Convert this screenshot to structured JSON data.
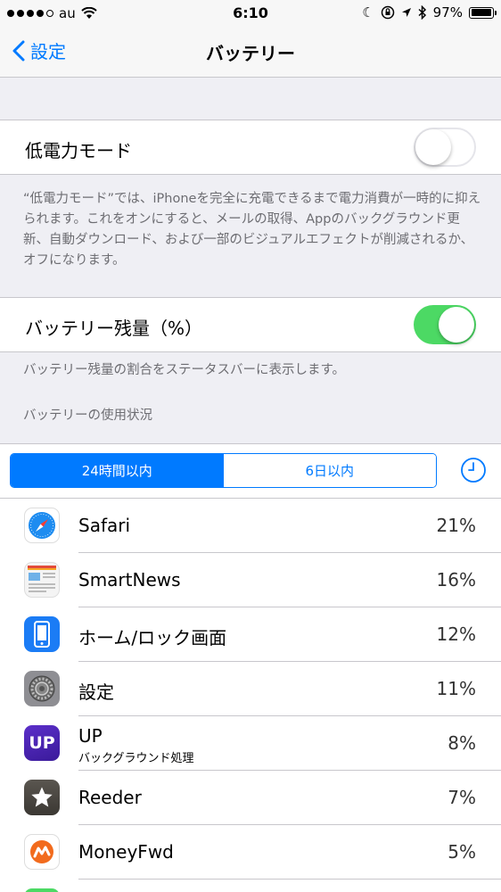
{
  "status": {
    "carrier": "au",
    "time": "6:10",
    "battery": "97%",
    "battery_level": 0.97
  },
  "nav": {
    "back_label": "設定",
    "title": "バッテリー"
  },
  "low_power": {
    "label": "低電力モード",
    "on": false,
    "footnote": "“低電力モード”では、iPhoneを完全に充電できるまで電力消費が一時的に抑えられます。これをオンにすると、メールの取得、Appのバックグラウンド更新、自動ダウンロード、および一部のビジュアルエフェクトが削減されるか、オフになります。"
  },
  "battery_pct": {
    "label": "バッテリー残量（%）",
    "on": true,
    "footnote": "バッテリー残量の割合をステータスバーに表示します。"
  },
  "usage": {
    "header": "バッテリーの使用状況",
    "segments": [
      "24時間以内",
      "6日以内"
    ],
    "selected": 0,
    "apps": [
      {
        "name": "Safari",
        "sub": "",
        "percent": "21%",
        "icon": "safari-icon"
      },
      {
        "name": "SmartNews",
        "sub": "",
        "percent": "16%",
        "icon": "smartnews-icon"
      },
      {
        "name": "ホーム/ロック画面",
        "sub": "",
        "percent": "12%",
        "icon": "phone-icon"
      },
      {
        "name": "設定",
        "sub": "",
        "percent": "11%",
        "icon": "gear-icon"
      },
      {
        "name": "UP",
        "sub": "バックグラウンド処理",
        "percent": "8%",
        "icon": "up-icon"
      },
      {
        "name": "Reeder",
        "sub": "",
        "percent": "7%",
        "icon": "star-icon"
      },
      {
        "name": "MoneyFwd",
        "sub": "",
        "percent": "5%",
        "icon": "moneyfwd-icon"
      }
    ]
  },
  "icon_text": {
    "up": "UP"
  },
  "colors": {
    "accent": "#007aff",
    "toggle_on": "#4cd964",
    "group_bg": "#efeff4"
  }
}
